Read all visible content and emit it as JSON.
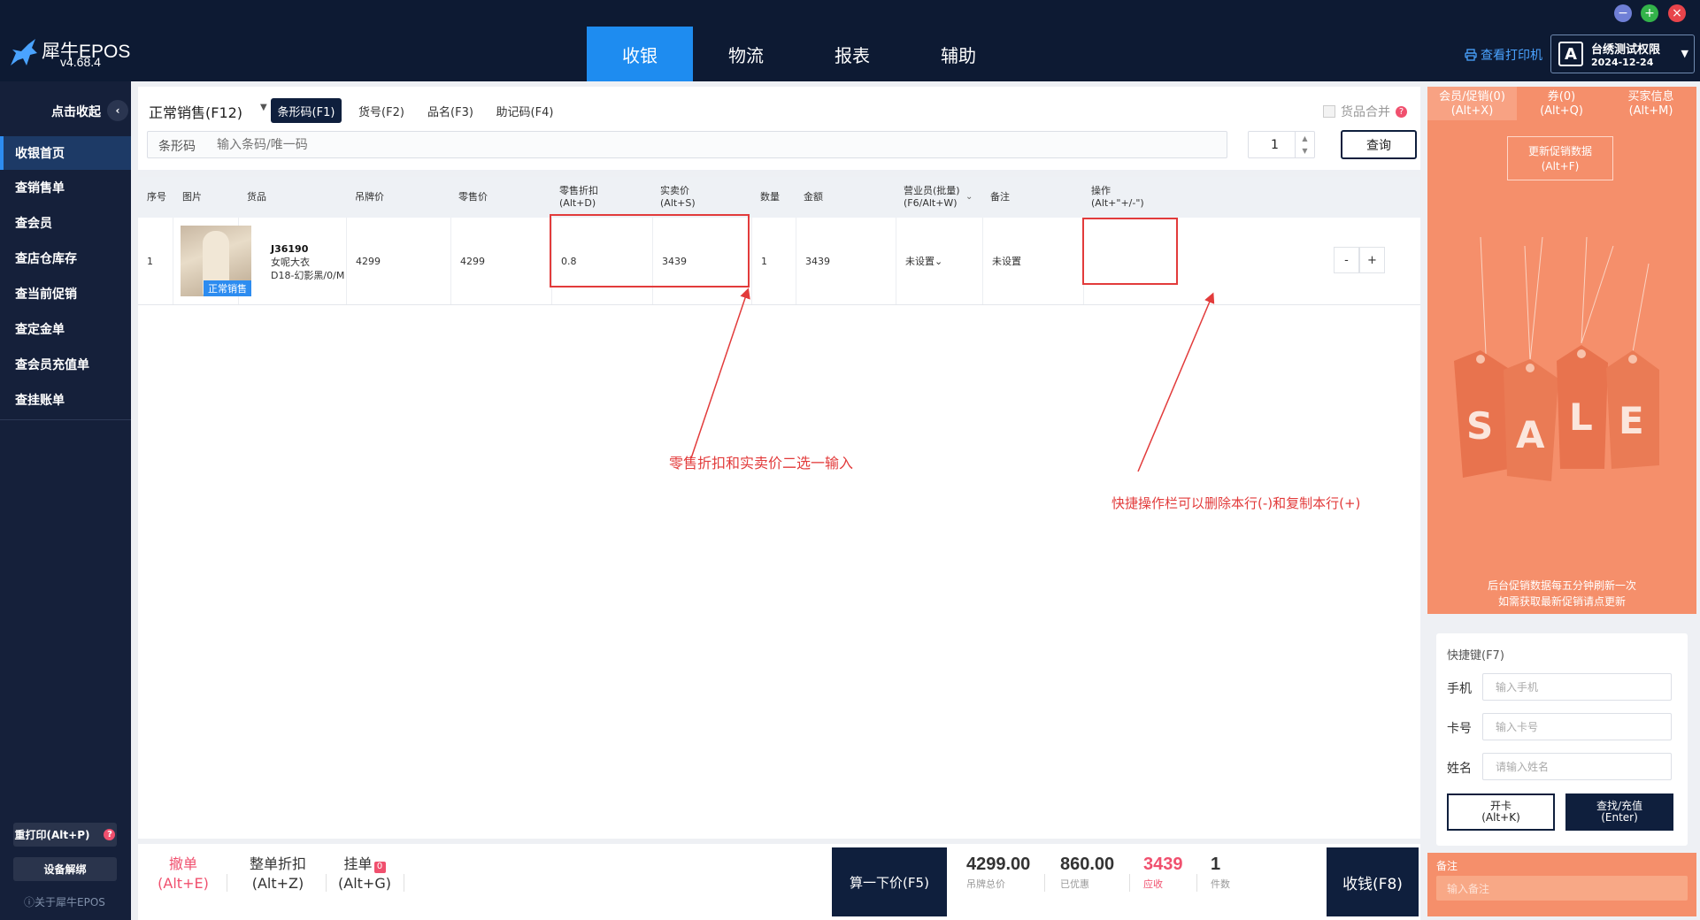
{
  "app": {
    "name": "犀牛EPOS",
    "version": "v4.68.4"
  },
  "nav": {
    "tabs": [
      {
        "label": "收银"
      },
      {
        "label": "物流"
      },
      {
        "label": "报表"
      },
      {
        "label": "辅助"
      }
    ]
  },
  "header": {
    "printer_label": "查看打印机",
    "user_initial": "A",
    "user_name": "台绣测试权限",
    "user_date": "2024-12-24"
  },
  "window_buttons": {
    "minimize": "−",
    "maximize": "+",
    "close": "×"
  },
  "sidebar": {
    "collapse_label": "点击收起",
    "items": [
      {
        "label": "收银首页"
      },
      {
        "label": "查销售单"
      },
      {
        "label": "查会员"
      },
      {
        "label": "查店仓库存"
      },
      {
        "label": "查当前促销"
      },
      {
        "label": "查定金单"
      },
      {
        "label": "查会员充值单"
      },
      {
        "label": "查挂账单"
      }
    ],
    "reprint_label": "重打印(Alt+P)",
    "reprint_badge": "?",
    "unbind_label": "设备解绑",
    "about_label": "ⓘ关于犀牛EPOS"
  },
  "search": {
    "sale_type": "正常销售(F12)",
    "modes": [
      {
        "label": "条形码(F1)"
      },
      {
        "label": "货号(F2)"
      },
      {
        "label": "品名(F3)"
      },
      {
        "label": "助记码(F4)"
      }
    ],
    "merge_label": "货品合并",
    "merge_help": "?",
    "barcode_label": "条形码",
    "barcode_placeholder": "输入条码/唯一码",
    "quantity": "1",
    "query_label": "查询"
  },
  "table": {
    "headers": {
      "index": "序号",
      "image": "图片",
      "goods": "货品",
      "tag_price": "吊牌价",
      "retail_price": "零售价",
      "discount": "零售折扣",
      "discount_key": "(Alt+D)",
      "actual_price": "实卖价",
      "actual_key": "(Alt+S)",
      "qty": "数量",
      "amount": "金额",
      "clerk": "营业员(批量)",
      "clerk_key": "(F6/Alt+W)",
      "remark": "备注",
      "ops": "操作",
      "ops_key": "(Alt+\"+/-\")"
    },
    "rows": [
      {
        "index": "1",
        "image_tag": "正常销售",
        "code": "J36190",
        "name": "女呢大衣",
        "spec": "D18-幻影黑/0/M",
        "tag_price": "4299",
        "retail_price": "4299",
        "discount": "0.8",
        "actual_price": "3439",
        "qty": "1",
        "amount": "3439",
        "clerk": "未设置",
        "remark": "未设置",
        "minus": "-",
        "plus": "+"
      }
    ]
  },
  "annotations": {
    "price": "零售折扣和实卖价二选一输入",
    "ops": "快捷操作栏可以删除本行(-)和复制本行(+)"
  },
  "bottom": {
    "undo": "撤单",
    "undo_key": "(Alt+E)",
    "discount": "整单折扣",
    "discount_key": "(Alt+Z)",
    "hold": "挂单",
    "hold_badge": "0",
    "hold_key": "(Alt+G)",
    "calc": "算一下价(F5)",
    "tag_total": "4299.00",
    "tag_total_label": "吊牌总价",
    "discounted": "860.00",
    "discounted_label": "已优惠",
    "receivable": "3439",
    "receivable_label": "应收",
    "count": "1",
    "count_label": "件数",
    "pay": "收钱(F8)"
  },
  "promo": {
    "tabs": [
      {
        "label": "会员/促销(0)",
        "key": "(Alt+X)"
      },
      {
        "label": "券(0)",
        "key": "(Alt+Q)"
      },
      {
        "label": "买家信息",
        "key": "(Alt+M)"
      }
    ],
    "refresh_label": "更新促销数据",
    "refresh_key": "(Alt+F)",
    "sale_letters": [
      "S",
      "A",
      "L",
      "E"
    ],
    "note_line1": "后台促销数据每五分钟刷新一次",
    "note_line2": "如需获取最新促销请点更新"
  },
  "member": {
    "title": "快捷键(F7)",
    "phone_label": "手机",
    "phone_placeholder": "输入手机",
    "card_label": "卡号",
    "card_placeholder": "输入卡号",
    "name_label": "姓名",
    "name_placeholder": "请输入姓名",
    "open_card": "开卡",
    "open_card_key": "(Alt+K)",
    "find": "查找/充值",
    "find_key": "(Enter)"
  },
  "remark": {
    "label": "备注",
    "placeholder": "输入备注"
  },
  "colors": {
    "accent": "#1e8cf0",
    "dark": "#0f1f3d",
    "promo": "#f58f6b",
    "highlight": "#e23b3b",
    "receivable": "#f0506e"
  }
}
